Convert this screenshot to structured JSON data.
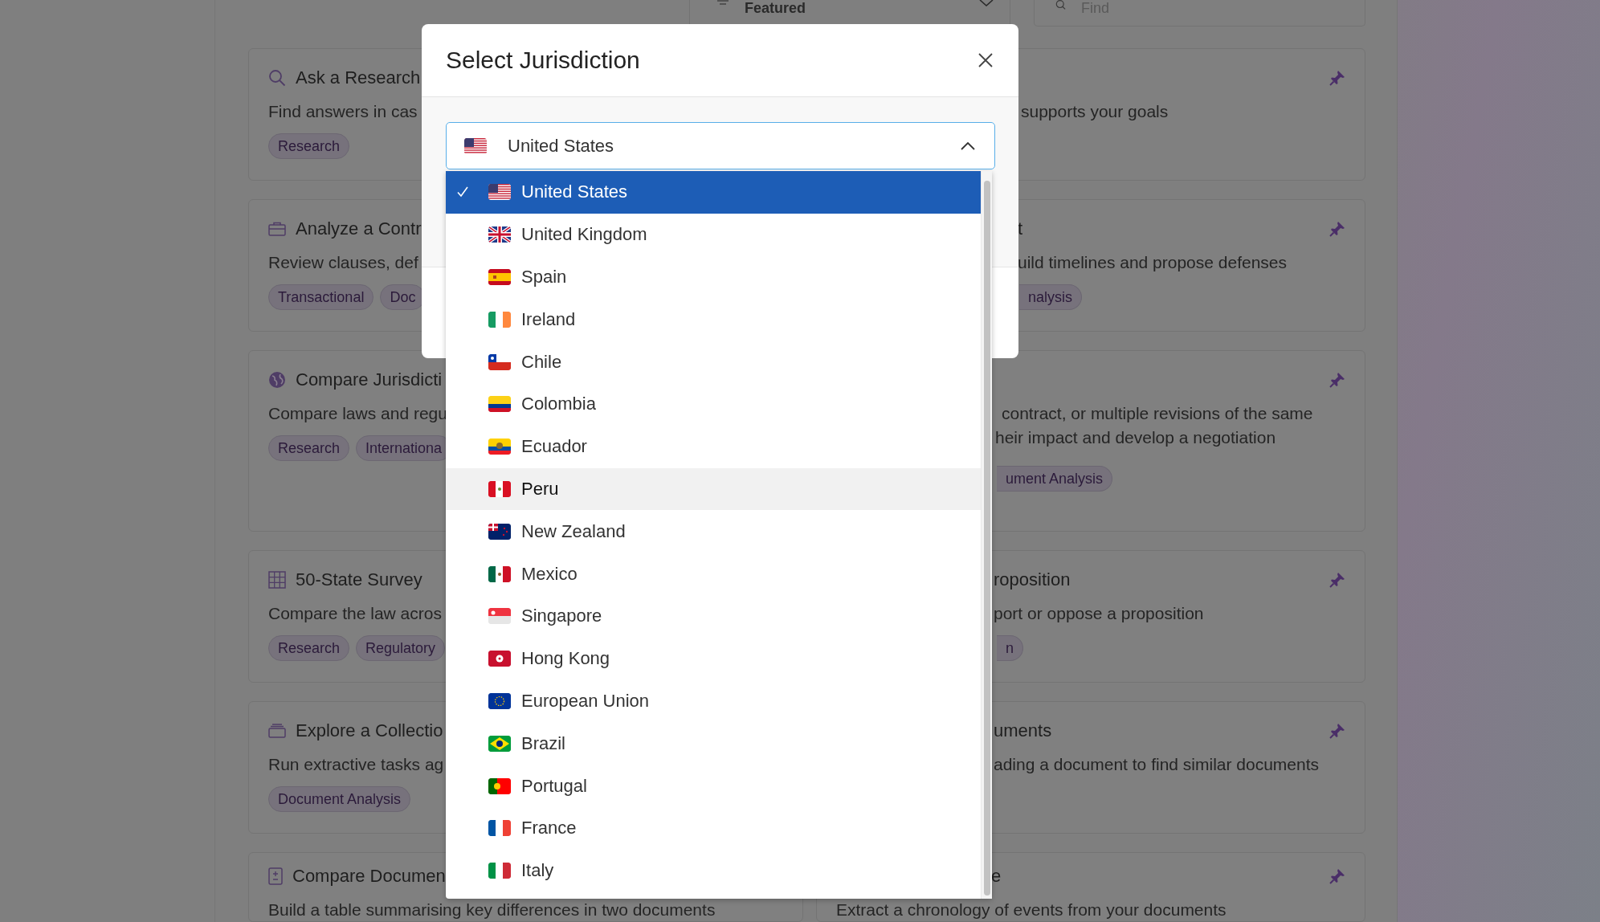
{
  "toolbar": {
    "sort": {
      "label": "Featured"
    },
    "search": {
      "placeholder": "Find"
    }
  },
  "left_cards": [
    {
      "title": "Ask a Research",
      "description": [
        "Find answers in cas"
      ],
      "tags": [
        "Research"
      ]
    },
    {
      "title": "Analyze a Contr",
      "description": [
        "Review clauses, def"
      ],
      "tags": [
        "Transactional",
        "Doc"
      ]
    },
    {
      "title": "Compare Jurisdicti",
      "description": [
        "Compare laws and regu"
      ],
      "tags": [
        "Research",
        "Internationa"
      ]
    },
    {
      "title": "50-State Survey",
      "description": [
        "Compare the law acros"
      ],
      "tags": [
        "Research",
        "Regulatory"
      ]
    },
    {
      "title": "Explore a Collectio",
      "description": [
        "Run extractive tasks ag"
      ],
      "tags": [
        "Document Analysis"
      ]
    },
    {
      "title": "Compare Documen",
      "description": [
        "Build a table summarising key differences in two documents"
      ]
    }
  ],
  "right_cards": [
    {
      "description": [
        "supports your goals"
      ],
      "pinned": true
    },
    {
      "title": "t",
      "description": [
        "uild timelines and propose defenses"
      ],
      "tags": [
        "nalysis"
      ],
      "pinned": true
    },
    {
      "description": [
        "contract, or multiple revisions of the same",
        "heir impact and develop a negotiation"
      ],
      "tags": [
        "ument Analysis"
      ],
      "pinned": true
    },
    {
      "title": "roposition",
      "description": [
        "port or oppose a proposition"
      ],
      "tags": [
        "n"
      ],
      "pinned": true
    },
    {
      "title": "uments",
      "description": [
        "ading a document to find similar documents"
      ],
      "pinned": true
    },
    {
      "title": "e",
      "description": [
        "Extract a chronology of events from your documents"
      ],
      "pinned": true
    }
  ],
  "modal": {
    "title": "Select Jurisdiction",
    "select": {
      "value": "United States",
      "expanded": true
    },
    "options": [
      {
        "label": "United States",
        "selected": true,
        "hovered": false
      },
      {
        "label": "United Kingdom",
        "selected": false,
        "hovered": false
      },
      {
        "label": "Spain",
        "selected": false,
        "hovered": false
      },
      {
        "label": "Ireland",
        "selected": false,
        "hovered": false
      },
      {
        "label": "Chile",
        "selected": false,
        "hovered": false
      },
      {
        "label": "Colombia",
        "selected": false,
        "hovered": false
      },
      {
        "label": "Ecuador",
        "selected": false,
        "hovered": false
      },
      {
        "label": "Peru",
        "selected": false,
        "hovered": true
      },
      {
        "label": "New Zealand",
        "selected": false,
        "hovered": false
      },
      {
        "label": "Mexico",
        "selected": false,
        "hovered": false
      },
      {
        "label": "Singapore",
        "selected": false,
        "hovered": false
      },
      {
        "label": "Hong Kong",
        "selected": false,
        "hovered": false
      },
      {
        "label": "European Union",
        "selected": false,
        "hovered": false
      },
      {
        "label": "Brazil",
        "selected": false,
        "hovered": false
      },
      {
        "label": "Portugal",
        "selected": false,
        "hovered": false
      },
      {
        "label": "France",
        "selected": false,
        "hovered": false
      },
      {
        "label": "Italy",
        "selected": false,
        "hovered": false
      }
    ]
  }
}
